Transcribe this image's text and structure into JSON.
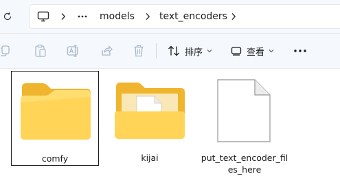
{
  "address_bar": {
    "breadcrumbs": [
      {
        "label": "models"
      },
      {
        "label": "text_encoders"
      }
    ]
  },
  "command_bar": {
    "sort_label": "排序",
    "view_label": "查看"
  },
  "items": [
    {
      "name": "comfy",
      "type": "folder",
      "selected": true
    },
    {
      "name": "kijai",
      "type": "folder-with-file",
      "selected": false
    },
    {
      "name_line1": "put_text_encoder_fil",
      "name_line2": "es_here",
      "type": "file",
      "selected": false
    }
  ],
  "colors": {
    "folder_front": "#ffd256",
    "folder_back": "#f2b733",
    "accent": "#005fb8",
    "toolbar_bg": "#f5f8fc"
  }
}
